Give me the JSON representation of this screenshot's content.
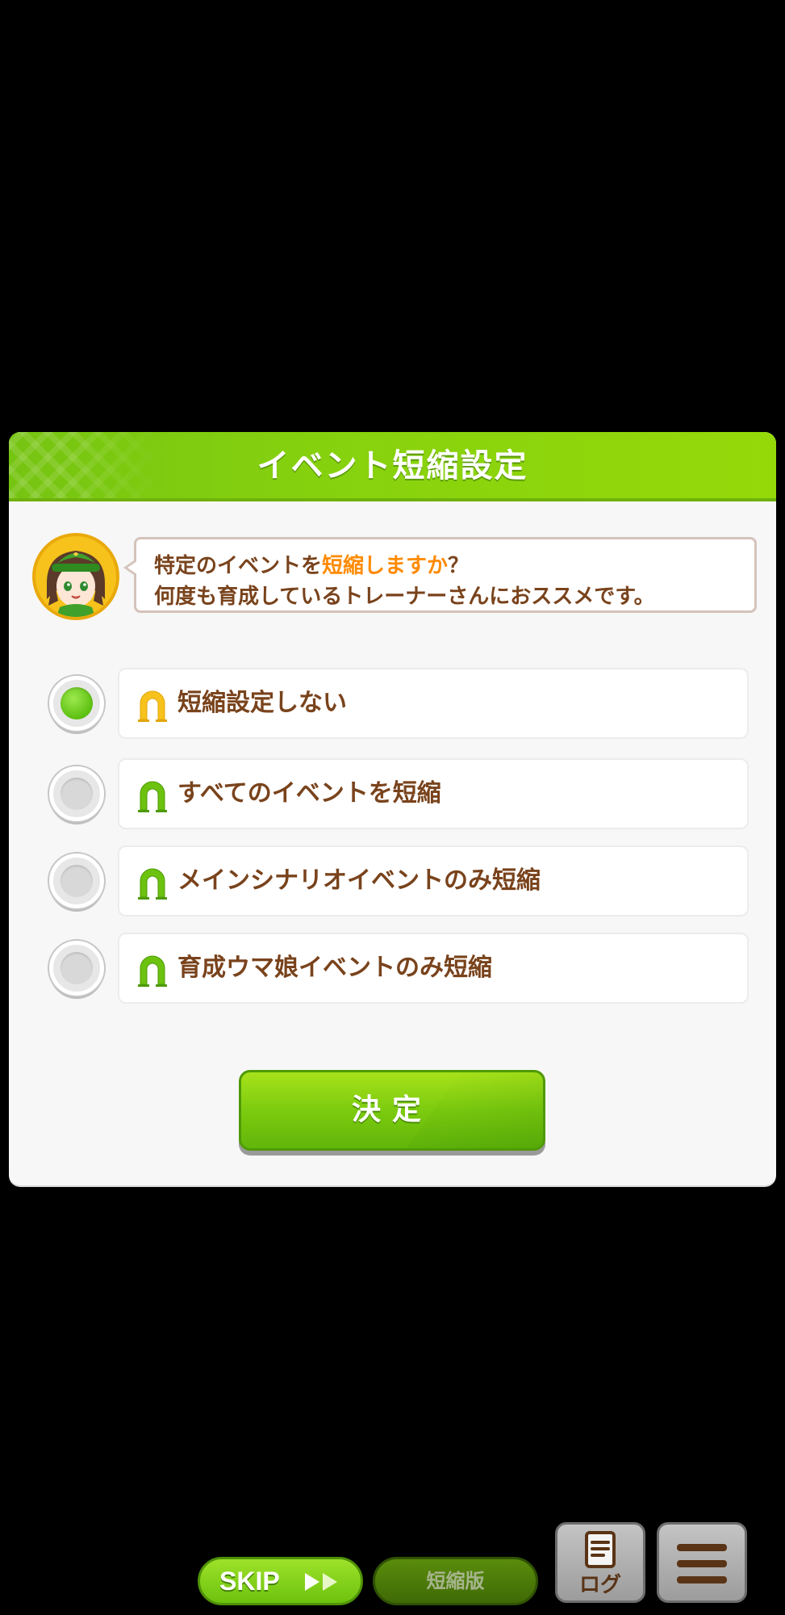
{
  "dialog": {
    "title": "イベント短縮設定",
    "message_line1_prefix": "特定のイベントを",
    "message_line1_highlight": "短縮しますか",
    "message_line1_suffix": "？",
    "message_line2": "何度も育成しているトレーナーさんにおススメです。",
    "options": [
      {
        "label": "短縮設定しない",
        "selected": true
      },
      {
        "label": "すべてのイベントを短縮",
        "selected": false
      },
      {
        "label": "メインシナリオイベントのみ短縮",
        "selected": false
      },
      {
        "label": "育成ウマ娘イベントのみ短縮",
        "selected": false
      }
    ],
    "confirm_label": "決定"
  },
  "bottom_bar": {
    "skip_label": "SKIP",
    "short_label": "短縮版",
    "log_label": "ログ"
  },
  "colors": {
    "accent_green": "#7ccb0f",
    "text_brown": "#79431c",
    "highlight_orange": "#ff8a00",
    "horseshoe_selected": "#f6c21b",
    "horseshoe_default": "#6cc20e"
  }
}
